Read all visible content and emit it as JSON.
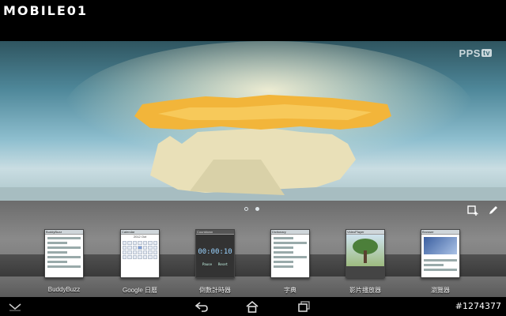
{
  "watermark": {
    "brand": "MOBILE01",
    "tag": "#1274377"
  },
  "video": {
    "logo": "PPS",
    "logo_tag": "tv"
  },
  "panel": {
    "page_indicator": {
      "pages": 2,
      "active": 2
    },
    "actions": [
      {
        "icon": "add-widget-icon"
      },
      {
        "icon": "edit-pencil-icon"
      }
    ]
  },
  "widgets": [
    {
      "id": "buddybuzz",
      "label": "BuddyBuzz",
      "header": "BuddyBuzz"
    },
    {
      "id": "google-calendar",
      "label": "Google 日曆",
      "header": "Calendar",
      "header_value": "2012 Oct"
    },
    {
      "id": "countdown",
      "label": "倒數計時器",
      "header": "Countdown",
      "time": "00:00:10",
      "buttons": [
        "Pause",
        "Reset"
      ]
    },
    {
      "id": "dictionary",
      "label": "字典",
      "header": "Dictionary"
    },
    {
      "id": "video-player",
      "label": "影片播放器",
      "header": "VideoPlayer"
    },
    {
      "id": "browser",
      "label": "瀏覽器",
      "header": "Browser"
    }
  ],
  "navbar": {
    "buttons": [
      {
        "icon": "hide-keyboard-chevron-icon"
      },
      {
        "icon": "back-arrow-icon"
      },
      {
        "icon": "home-icon"
      },
      {
        "icon": "recent-apps-icon"
      },
      {
        "icon": "menu-icon"
      }
    ]
  },
  "colors": {
    "accent_timer": "#9ad3ff",
    "panel_gray": "#7a7a7a",
    "sky_blue": "#4e8799"
  }
}
